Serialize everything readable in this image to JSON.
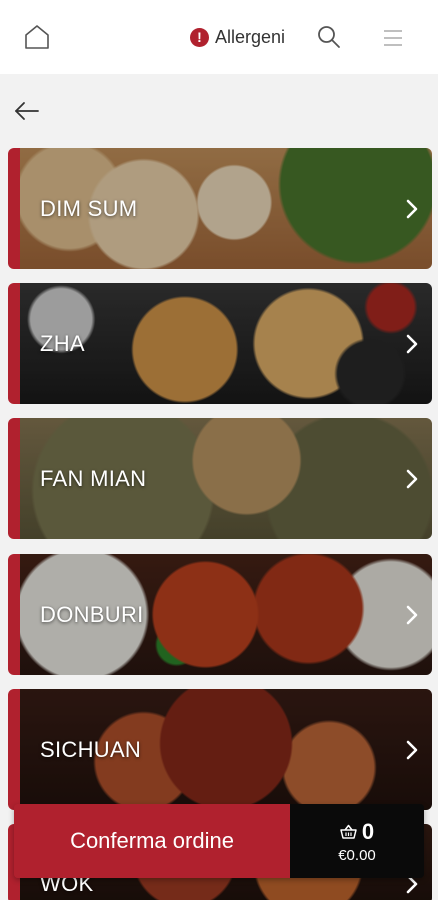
{
  "header": {
    "home_icon": "home-icon",
    "allergen_icon": "alert-circle-icon",
    "allergen_label": "Allergeni",
    "search_icon": "search-icon",
    "menu_icon": "hamburger-menu-icon"
  },
  "nav": {
    "back_icon": "arrow-left-icon"
  },
  "categories": [
    {
      "label": "DIM SUM"
    },
    {
      "label": "ZHA"
    },
    {
      "label": "FAN MIAN"
    },
    {
      "label": "DONBURI"
    },
    {
      "label": "SICHUAN"
    },
    {
      "label": "WOK"
    }
  ],
  "order": {
    "confirm_label": "Conferma ordine",
    "cart_count": "0",
    "cart_total": "€0.00",
    "basket_icon": "basket-icon"
  },
  "colors": {
    "accent": "#b0212e",
    "cart_bg": "#0a0a0a",
    "header_bg": "#ffffff",
    "page_bg": "#f2f2f2"
  }
}
